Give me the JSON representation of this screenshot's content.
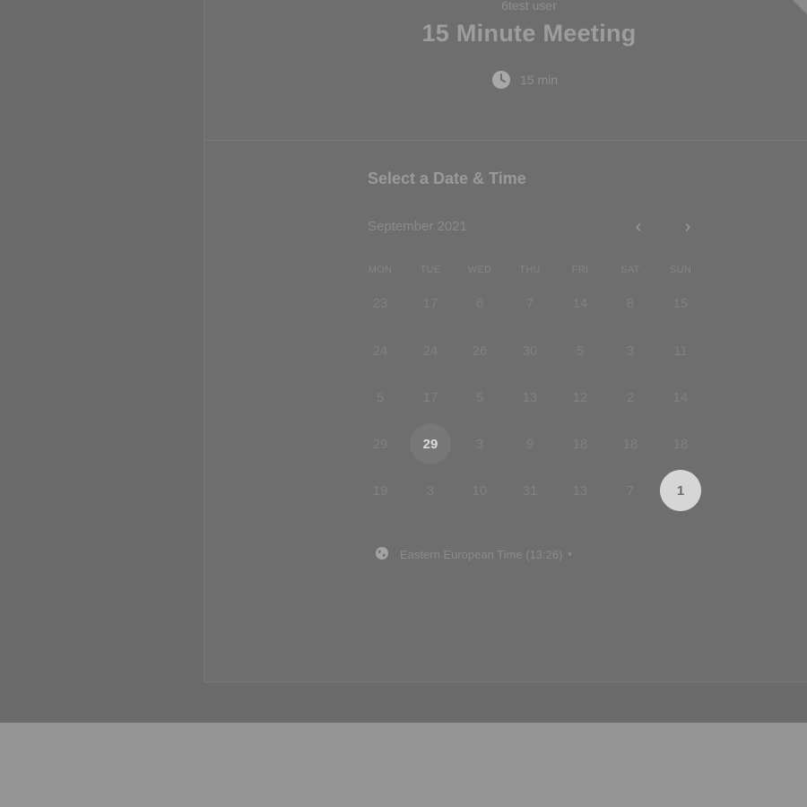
{
  "event": {
    "owner": "6test user",
    "title": "15 Minute Meeting",
    "duration": "15 min",
    "clock_icon": "clock-icon"
  },
  "scheduler": {
    "heading": "Select a Date & Time",
    "month": "September 2021",
    "prev_label": "‹",
    "next_label": "›",
    "weekdays": [
      "MON",
      "TUE",
      "WED",
      "THU",
      "FRI",
      "SAT",
      "SUN"
    ],
    "weeks": [
      [
        "23",
        "17",
        "6",
        "7",
        "14",
        "8",
        "15"
      ],
      [
        "24",
        "24",
        "26",
        "30",
        "5",
        "3",
        "11"
      ],
      [
        "5",
        "17",
        "5",
        "13",
        "12",
        "2",
        "14"
      ],
      [
        "29",
        "29",
        "3",
        "9",
        "18",
        "18",
        "18"
      ],
      [
        "19",
        "3",
        "10",
        "31",
        "13",
        "7",
        "1"
      ]
    ],
    "available_day": "29",
    "selected_day": "1",
    "timezone": "Eastern European Time (13:26)",
    "timezone_caret": "▾"
  },
  "colors": {
    "overlay": "#6b6b6b",
    "selected_bg": "#d6d6d6",
    "available_bg": "#777777"
  }
}
